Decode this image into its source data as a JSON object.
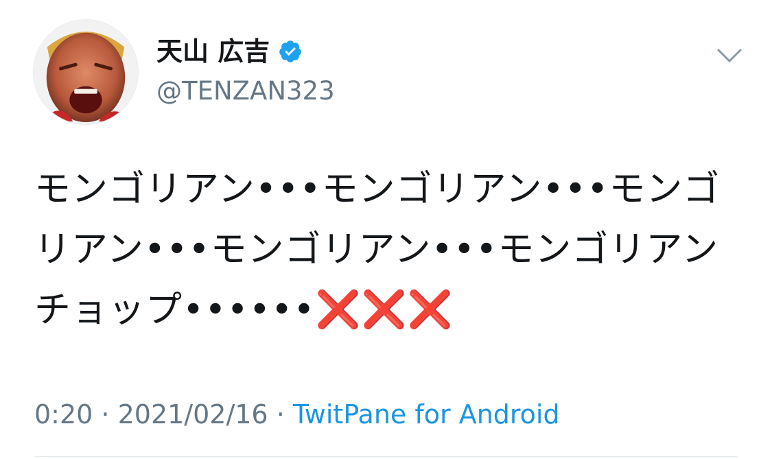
{
  "user": {
    "display_name": "天山 広吉",
    "handle": "@TENZAN323",
    "avatar_icon": "profile-photo",
    "verified_icon": "verified-badge-icon",
    "verified_color": "#1da1f2"
  },
  "menu": {
    "icon": "chevron-down-icon"
  },
  "tweet": {
    "text_main": "モンゴリアン•••モンゴリアン•••モンゴリアン•••モンゴリアン•••モンゴリアンチョップ••••••",
    "text_crosses": "❌❌❌",
    "cross_color": "#dd1111"
  },
  "meta": {
    "time": "0:20",
    "sep1": " · ",
    "date": "2021/02/16",
    "sep2": " · ",
    "source": "TwitPane for Android",
    "source_color": "#1b95e0"
  }
}
